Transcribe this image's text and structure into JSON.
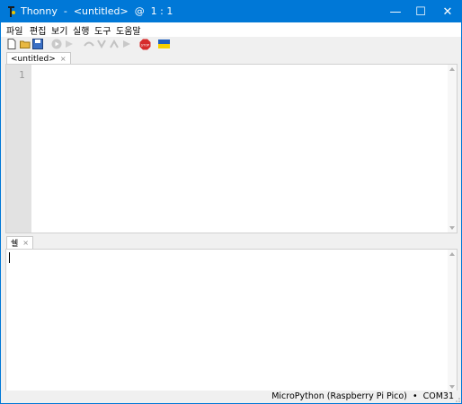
{
  "window": {
    "title": "Thonny  -  <untitled>  @  1 : 1",
    "controls": {
      "minimize": "—",
      "maximize": "☐",
      "close": "✕"
    }
  },
  "menu": [
    "파일",
    "편집",
    "보기",
    "실행",
    "도구",
    "도움말"
  ],
  "toolbar": {
    "buttons": [
      "new-file-icon",
      "open-file-icon",
      "save-icon",
      "run-icon",
      "debug-icon",
      "step-over-icon",
      "step-into-icon",
      "step-out-icon",
      "resume-icon",
      "stop-icon",
      "ukraine-flag-icon"
    ],
    "stop_label": "STOP"
  },
  "editor": {
    "tab_label": "<untitled>",
    "tab_close": "×",
    "line_numbers": [
      "1"
    ]
  },
  "shell": {
    "tab_label": "쉘",
    "tab_close": "×"
  },
  "status": {
    "interpreter": "MicroPython (Raspberry Pi Pico)",
    "separator": "•",
    "port": "COM31"
  },
  "colors": {
    "titlebar": "#0078d7",
    "gutter": "#e2e2e2",
    "stop": "#d62b2b",
    "flag_blue": "#1f5fbf",
    "flag_yellow": "#f5d000"
  }
}
